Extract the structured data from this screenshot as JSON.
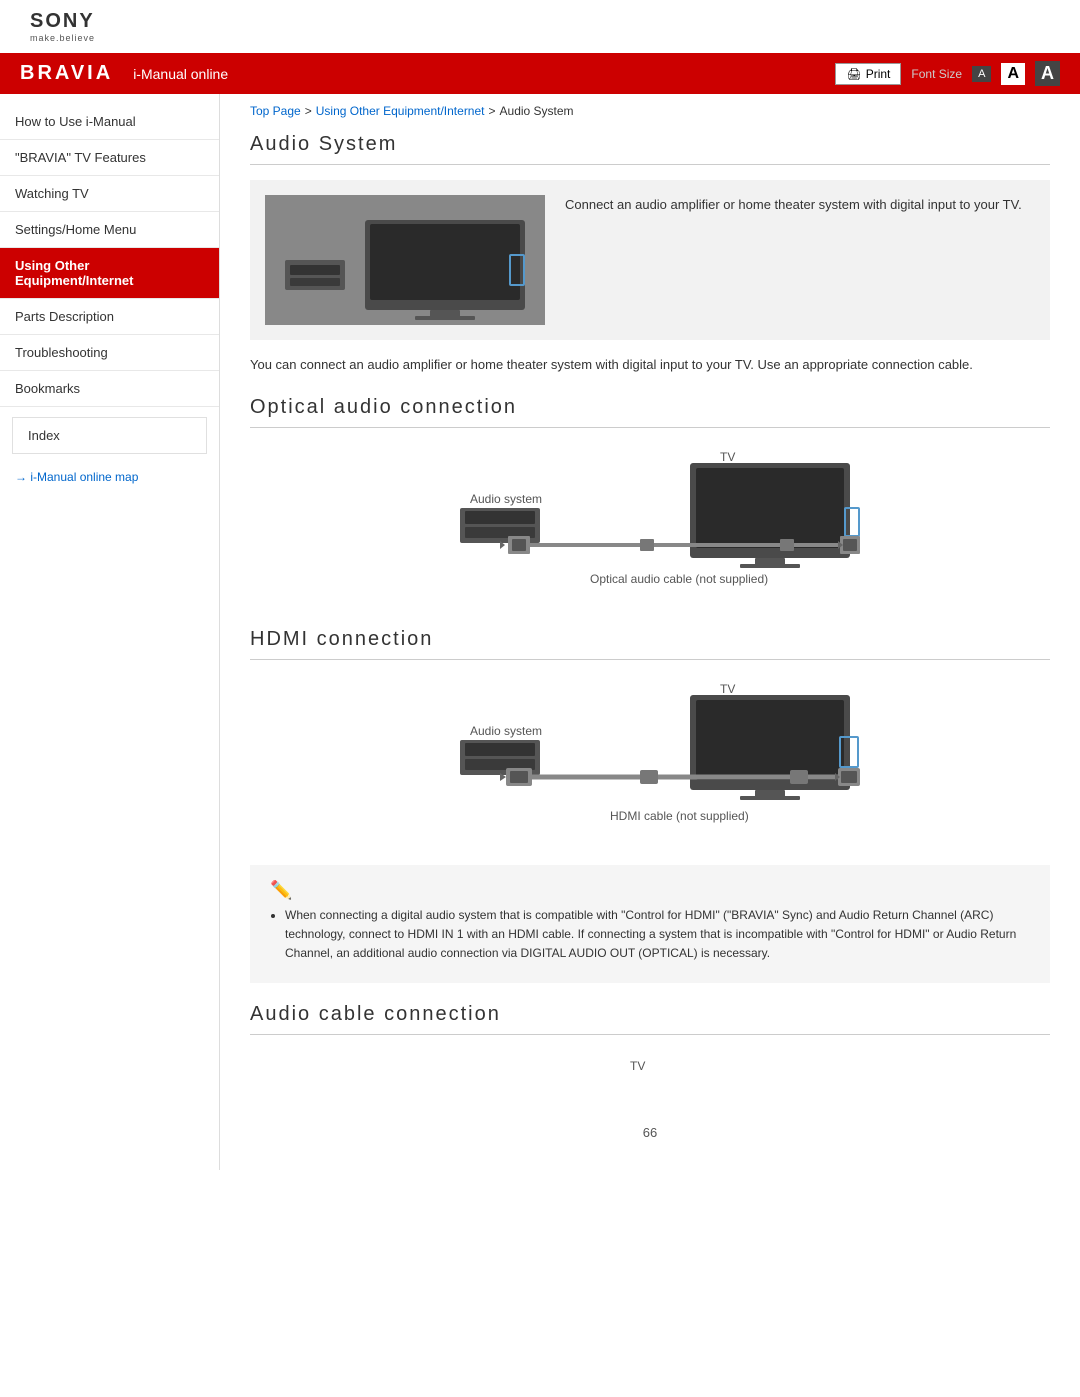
{
  "sony": {
    "logo": "SONY",
    "tagline": "make.believe"
  },
  "header": {
    "bravia": "BRAVIA",
    "manual_text": "i-Manual online",
    "print_label": "Print",
    "font_size_label": "Font Size",
    "font_small": "A",
    "font_medium": "A",
    "font_large": "A"
  },
  "breadcrumb": {
    "top_page": "Top Page",
    "separator1": ">",
    "equipment": "Using Other Equipment/Internet",
    "separator2": ">",
    "current": "Audio System"
  },
  "sidebar": {
    "items": [
      {
        "label": "How to Use i-Manual",
        "active": false
      },
      {
        "label": "\"BRAVIA\" TV Features",
        "active": false
      },
      {
        "label": "Watching TV",
        "active": false
      },
      {
        "label": "Settings/Home Menu",
        "active": false
      },
      {
        "label": "Using Other Equipment/Internet",
        "active": true
      },
      {
        "label": "Parts Description",
        "active": false
      },
      {
        "label": "Troubleshooting",
        "active": false
      },
      {
        "label": "Bookmarks",
        "active": false
      }
    ],
    "index_label": "Index",
    "map_link": "→  i-Manual online map"
  },
  "content": {
    "main_title": "Audio System",
    "intro_text": "Connect an audio amplifier or home theater system with digital input to your TV.",
    "intro_para": "You can connect an audio amplifier or home theater system with digital input to your TV. Use an appropriate connection cable.",
    "optical_title": "Optical audio connection",
    "optical_tv_label": "TV",
    "optical_audio_label": "Audio system",
    "optical_cable_label": "Optical audio cable (not supplied)",
    "hdmi_title": "HDMI connection",
    "hdmi_tv_label": "TV",
    "hdmi_audio_label": "Audio system",
    "hdmi_cable_label": "HDMI cable (not supplied)",
    "note_text": "When connecting a digital audio system that is compatible with \"Control for HDMI\" (\"BRAVIA\" Sync) and Audio Return Channel (ARC) technology, connect to HDMI IN 1 with an HDMI cable. If connecting a system that is incompatible with \"Control for HDMI\" or Audio Return Channel, an additional audio connection via DIGITAL AUDIO OUT (OPTICAL) is necessary.",
    "audio_cable_title": "Audio cable connection",
    "audio_cable_tv_label": "TV",
    "page_number": "66"
  }
}
